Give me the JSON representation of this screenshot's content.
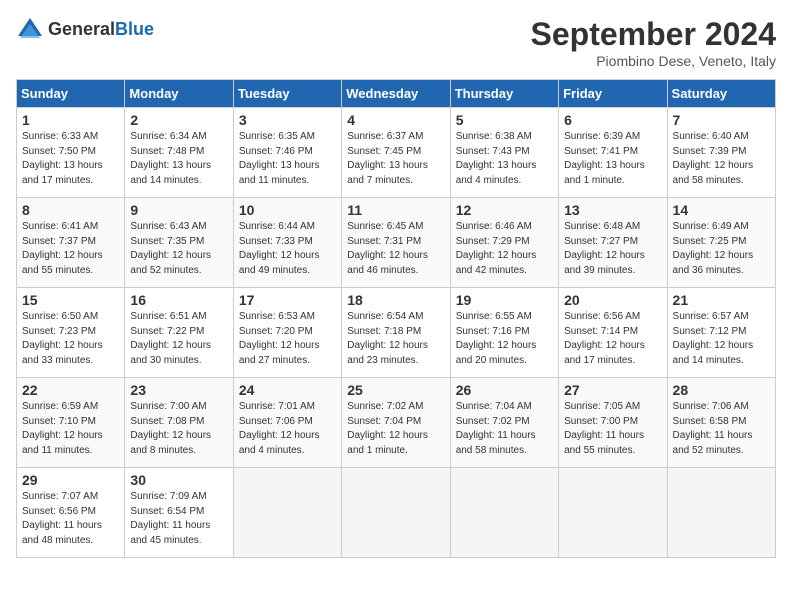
{
  "logo": {
    "text_general": "General",
    "text_blue": "Blue"
  },
  "header": {
    "month": "September 2024",
    "location": "Piombino Dese, Veneto, Italy"
  },
  "weekdays": [
    "Sunday",
    "Monday",
    "Tuesday",
    "Wednesday",
    "Thursday",
    "Friday",
    "Saturday"
  ],
  "weeks": [
    [
      {
        "day": "1",
        "info": "Sunrise: 6:33 AM\nSunset: 7:50 PM\nDaylight: 13 hours and 17 minutes."
      },
      {
        "day": "2",
        "info": "Sunrise: 6:34 AM\nSunset: 7:48 PM\nDaylight: 13 hours and 14 minutes."
      },
      {
        "day": "3",
        "info": "Sunrise: 6:35 AM\nSunset: 7:46 PM\nDaylight: 13 hours and 11 minutes."
      },
      {
        "day": "4",
        "info": "Sunrise: 6:37 AM\nSunset: 7:45 PM\nDaylight: 13 hours and 7 minutes."
      },
      {
        "day": "5",
        "info": "Sunrise: 6:38 AM\nSunset: 7:43 PM\nDaylight: 13 hours and 4 minutes."
      },
      {
        "day": "6",
        "info": "Sunrise: 6:39 AM\nSunset: 7:41 PM\nDaylight: 13 hours and 1 minute."
      },
      {
        "day": "7",
        "info": "Sunrise: 6:40 AM\nSunset: 7:39 PM\nDaylight: 12 hours and 58 minutes."
      }
    ],
    [
      {
        "day": "8",
        "info": "Sunrise: 6:41 AM\nSunset: 7:37 PM\nDaylight: 12 hours and 55 minutes."
      },
      {
        "day": "9",
        "info": "Sunrise: 6:43 AM\nSunset: 7:35 PM\nDaylight: 12 hours and 52 minutes."
      },
      {
        "day": "10",
        "info": "Sunrise: 6:44 AM\nSunset: 7:33 PM\nDaylight: 12 hours and 49 minutes."
      },
      {
        "day": "11",
        "info": "Sunrise: 6:45 AM\nSunset: 7:31 PM\nDaylight: 12 hours and 46 minutes."
      },
      {
        "day": "12",
        "info": "Sunrise: 6:46 AM\nSunset: 7:29 PM\nDaylight: 12 hours and 42 minutes."
      },
      {
        "day": "13",
        "info": "Sunrise: 6:48 AM\nSunset: 7:27 PM\nDaylight: 12 hours and 39 minutes."
      },
      {
        "day": "14",
        "info": "Sunrise: 6:49 AM\nSunset: 7:25 PM\nDaylight: 12 hours and 36 minutes."
      }
    ],
    [
      {
        "day": "15",
        "info": "Sunrise: 6:50 AM\nSunset: 7:23 PM\nDaylight: 12 hours and 33 minutes."
      },
      {
        "day": "16",
        "info": "Sunrise: 6:51 AM\nSunset: 7:22 PM\nDaylight: 12 hours and 30 minutes."
      },
      {
        "day": "17",
        "info": "Sunrise: 6:53 AM\nSunset: 7:20 PM\nDaylight: 12 hours and 27 minutes."
      },
      {
        "day": "18",
        "info": "Sunrise: 6:54 AM\nSunset: 7:18 PM\nDaylight: 12 hours and 23 minutes."
      },
      {
        "day": "19",
        "info": "Sunrise: 6:55 AM\nSunset: 7:16 PM\nDaylight: 12 hours and 20 minutes."
      },
      {
        "day": "20",
        "info": "Sunrise: 6:56 AM\nSunset: 7:14 PM\nDaylight: 12 hours and 17 minutes."
      },
      {
        "day": "21",
        "info": "Sunrise: 6:57 AM\nSunset: 7:12 PM\nDaylight: 12 hours and 14 minutes."
      }
    ],
    [
      {
        "day": "22",
        "info": "Sunrise: 6:59 AM\nSunset: 7:10 PM\nDaylight: 12 hours and 11 minutes."
      },
      {
        "day": "23",
        "info": "Sunrise: 7:00 AM\nSunset: 7:08 PM\nDaylight: 12 hours and 8 minutes."
      },
      {
        "day": "24",
        "info": "Sunrise: 7:01 AM\nSunset: 7:06 PM\nDaylight: 12 hours and 4 minutes."
      },
      {
        "day": "25",
        "info": "Sunrise: 7:02 AM\nSunset: 7:04 PM\nDaylight: 12 hours and 1 minute."
      },
      {
        "day": "26",
        "info": "Sunrise: 7:04 AM\nSunset: 7:02 PM\nDaylight: 11 hours and 58 minutes."
      },
      {
        "day": "27",
        "info": "Sunrise: 7:05 AM\nSunset: 7:00 PM\nDaylight: 11 hours and 55 minutes."
      },
      {
        "day": "28",
        "info": "Sunrise: 7:06 AM\nSunset: 6:58 PM\nDaylight: 11 hours and 52 minutes."
      }
    ],
    [
      {
        "day": "29",
        "info": "Sunrise: 7:07 AM\nSunset: 6:56 PM\nDaylight: 11 hours and 48 minutes."
      },
      {
        "day": "30",
        "info": "Sunrise: 7:09 AM\nSunset: 6:54 PM\nDaylight: 11 hours and 45 minutes."
      },
      {
        "day": "",
        "info": ""
      },
      {
        "day": "",
        "info": ""
      },
      {
        "day": "",
        "info": ""
      },
      {
        "day": "",
        "info": ""
      },
      {
        "day": "",
        "info": ""
      }
    ]
  ]
}
